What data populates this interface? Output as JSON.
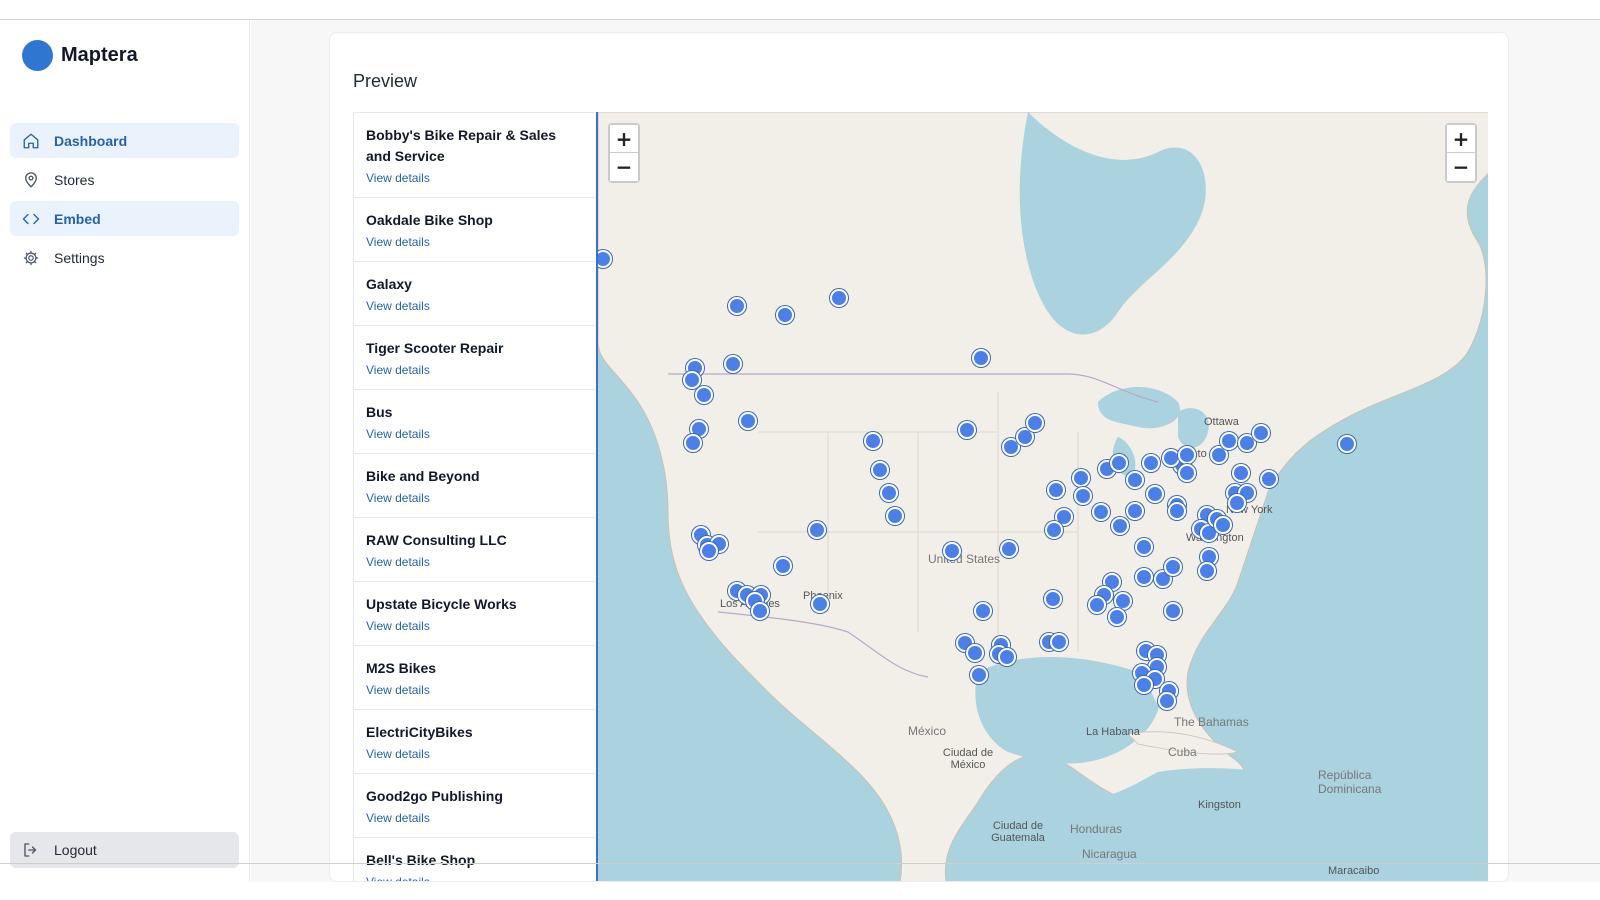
{
  "app": {
    "name": "Maptera",
    "brand_color": "#2f76d2",
    "accent": "#2563a8"
  },
  "sidebar": {
    "items": [
      {
        "label": "Dashboard",
        "icon": "home-icon",
        "active": true
      },
      {
        "label": "Stores",
        "icon": "map-pin-icon",
        "active": false
      },
      {
        "label": "Embed",
        "icon": "code-icon",
        "active": true
      },
      {
        "label": "Settings",
        "icon": "gear-icon",
        "active": false
      }
    ],
    "logout_label": "Logout",
    "logout_icon": "logout-icon"
  },
  "preview": {
    "title": "Preview",
    "view_details_label": "View details",
    "stores": [
      "Bobby's Bike Repair & Sales and Service",
      "Oakdale Bike Shop",
      "Galaxy",
      "Tiger Scooter Repair",
      "Bus",
      "Bike and Beyond",
      "RAW Consulting LLC",
      "Upstate Bicycle Works",
      "M2S Bikes",
      "ElectriCityBikes",
      "Good2go Publishing",
      "Bell's Bike Shop"
    ]
  },
  "map": {
    "zoom_in": "+",
    "zoom_out": "−",
    "marker_color": "#4a80e8",
    "labels": {
      "ottawa": "Ottawa",
      "united_states": "United States",
      "phoenix": "Phoenix",
      "los_angeles": "Los Angeles",
      "washington": "Washington",
      "new_york": "New York",
      "toronto": "Toronto",
      "mexico": "México",
      "mexico_city": "Ciudad de México",
      "la_habana": "La Habana",
      "cuba": "Cuba",
      "the_bahamas": "The Bahamas",
      "republica_dominicana": "República Dominicana",
      "kingston": "Kingston",
      "honduras": "Honduras",
      "ciudad_de_guatemala": "Ciudad de Guatemala",
      "nicaragua": "Nicaragua",
      "maracaibo": "Maracaibo"
    }
  }
}
